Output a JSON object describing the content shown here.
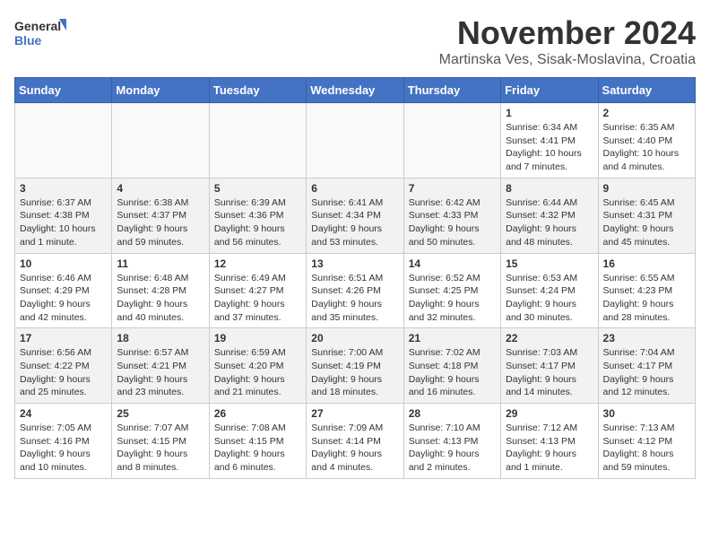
{
  "logo": {
    "general": "General",
    "blue": "Blue"
  },
  "header": {
    "month": "November 2024",
    "location": "Martinska Ves, Sisak-Moslavina, Croatia"
  },
  "weekdays": [
    "Sunday",
    "Monday",
    "Tuesday",
    "Wednesday",
    "Thursday",
    "Friday",
    "Saturday"
  ],
  "weeks": [
    [
      {
        "day": "",
        "info": ""
      },
      {
        "day": "",
        "info": ""
      },
      {
        "day": "",
        "info": ""
      },
      {
        "day": "",
        "info": ""
      },
      {
        "day": "",
        "info": ""
      },
      {
        "day": "1",
        "info": "Sunrise: 6:34 AM\nSunset: 4:41 PM\nDaylight: 10 hours and 7 minutes."
      },
      {
        "day": "2",
        "info": "Sunrise: 6:35 AM\nSunset: 4:40 PM\nDaylight: 10 hours and 4 minutes."
      }
    ],
    [
      {
        "day": "3",
        "info": "Sunrise: 6:37 AM\nSunset: 4:38 PM\nDaylight: 10 hours and 1 minute."
      },
      {
        "day": "4",
        "info": "Sunrise: 6:38 AM\nSunset: 4:37 PM\nDaylight: 9 hours and 59 minutes."
      },
      {
        "day": "5",
        "info": "Sunrise: 6:39 AM\nSunset: 4:36 PM\nDaylight: 9 hours and 56 minutes."
      },
      {
        "day": "6",
        "info": "Sunrise: 6:41 AM\nSunset: 4:34 PM\nDaylight: 9 hours and 53 minutes."
      },
      {
        "day": "7",
        "info": "Sunrise: 6:42 AM\nSunset: 4:33 PM\nDaylight: 9 hours and 50 minutes."
      },
      {
        "day": "8",
        "info": "Sunrise: 6:44 AM\nSunset: 4:32 PM\nDaylight: 9 hours and 48 minutes."
      },
      {
        "day": "9",
        "info": "Sunrise: 6:45 AM\nSunset: 4:31 PM\nDaylight: 9 hours and 45 minutes."
      }
    ],
    [
      {
        "day": "10",
        "info": "Sunrise: 6:46 AM\nSunset: 4:29 PM\nDaylight: 9 hours and 42 minutes."
      },
      {
        "day": "11",
        "info": "Sunrise: 6:48 AM\nSunset: 4:28 PM\nDaylight: 9 hours and 40 minutes."
      },
      {
        "day": "12",
        "info": "Sunrise: 6:49 AM\nSunset: 4:27 PM\nDaylight: 9 hours and 37 minutes."
      },
      {
        "day": "13",
        "info": "Sunrise: 6:51 AM\nSunset: 4:26 PM\nDaylight: 9 hours and 35 minutes."
      },
      {
        "day": "14",
        "info": "Sunrise: 6:52 AM\nSunset: 4:25 PM\nDaylight: 9 hours and 32 minutes."
      },
      {
        "day": "15",
        "info": "Sunrise: 6:53 AM\nSunset: 4:24 PM\nDaylight: 9 hours and 30 minutes."
      },
      {
        "day": "16",
        "info": "Sunrise: 6:55 AM\nSunset: 4:23 PM\nDaylight: 9 hours and 28 minutes."
      }
    ],
    [
      {
        "day": "17",
        "info": "Sunrise: 6:56 AM\nSunset: 4:22 PM\nDaylight: 9 hours and 25 minutes."
      },
      {
        "day": "18",
        "info": "Sunrise: 6:57 AM\nSunset: 4:21 PM\nDaylight: 9 hours and 23 minutes."
      },
      {
        "day": "19",
        "info": "Sunrise: 6:59 AM\nSunset: 4:20 PM\nDaylight: 9 hours and 21 minutes."
      },
      {
        "day": "20",
        "info": "Sunrise: 7:00 AM\nSunset: 4:19 PM\nDaylight: 9 hours and 18 minutes."
      },
      {
        "day": "21",
        "info": "Sunrise: 7:02 AM\nSunset: 4:18 PM\nDaylight: 9 hours and 16 minutes."
      },
      {
        "day": "22",
        "info": "Sunrise: 7:03 AM\nSunset: 4:17 PM\nDaylight: 9 hours and 14 minutes."
      },
      {
        "day": "23",
        "info": "Sunrise: 7:04 AM\nSunset: 4:17 PM\nDaylight: 9 hours and 12 minutes."
      }
    ],
    [
      {
        "day": "24",
        "info": "Sunrise: 7:05 AM\nSunset: 4:16 PM\nDaylight: 9 hours and 10 minutes."
      },
      {
        "day": "25",
        "info": "Sunrise: 7:07 AM\nSunset: 4:15 PM\nDaylight: 9 hours and 8 minutes."
      },
      {
        "day": "26",
        "info": "Sunrise: 7:08 AM\nSunset: 4:15 PM\nDaylight: 9 hours and 6 minutes."
      },
      {
        "day": "27",
        "info": "Sunrise: 7:09 AM\nSunset: 4:14 PM\nDaylight: 9 hours and 4 minutes."
      },
      {
        "day": "28",
        "info": "Sunrise: 7:10 AM\nSunset: 4:13 PM\nDaylight: 9 hours and 2 minutes."
      },
      {
        "day": "29",
        "info": "Sunrise: 7:12 AM\nSunset: 4:13 PM\nDaylight: 9 hours and 1 minute."
      },
      {
        "day": "30",
        "info": "Sunrise: 7:13 AM\nSunset: 4:12 PM\nDaylight: 8 hours and 59 minutes."
      }
    ]
  ]
}
